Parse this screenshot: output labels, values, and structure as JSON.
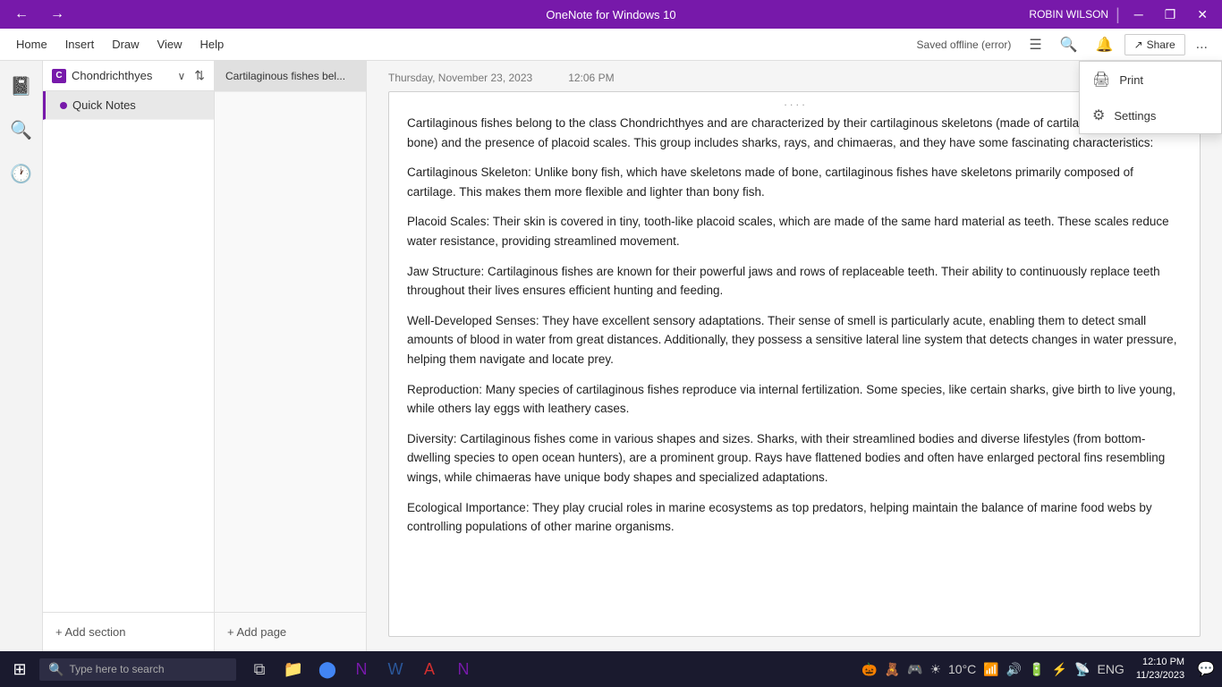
{
  "titleBar": {
    "appName": "OneNote for Windows 10",
    "userName": "ROBIN WILSON",
    "navBack": "←",
    "navForward": "→",
    "minBtn": "─",
    "maxBtn": "❐",
    "closeBtn": "✕"
  },
  "menuBar": {
    "items": [
      "Home",
      "Insert",
      "Draw",
      "View",
      "Help"
    ],
    "status": "Saved offline (error)",
    "shareBtn": "Share",
    "moreBtn": "..."
  },
  "sidePanel": {
    "notebookName": "Chondrichthyes",
    "pages": [
      {
        "label": "Quick Notes",
        "active": true
      }
    ],
    "addSection": "+ Add section",
    "addPage": "+ Add page"
  },
  "pageList": {
    "items": [
      "Cartilaginous fishes bel..."
    ]
  },
  "content": {
    "date": "Thursday, November 23, 2023",
    "time": "12:06 PM",
    "noteText": [
      "Cartilaginous fishes belong to the class Chondrichthyes and are characterized by their cartilaginous skeletons (made of cartilage instead of bone) and the presence of placoid scales. This group includes sharks, rays, and chimaeras, and they have some fascinating characteristics:",
      "Cartilaginous Skeleton: Unlike bony fish, which have skeletons made of bone, cartilaginous fishes have skeletons primarily composed of cartilage. This makes them more flexible and lighter than bony fish.",
      "Placoid Scales: Their skin is covered in tiny, tooth-like placoid scales, which are made of the same hard material as teeth. These scales reduce water resistance, providing streamlined movement.",
      "Jaw Structure: Cartilaginous fishes are known for their powerful jaws and rows of replaceable teeth. Their ability to continuously replace teeth throughout their lives ensures efficient hunting and feeding.",
      "Well-Developed Senses: They have excellent sensory adaptations. Their sense of smell is particularly acute, enabling them to detect small amounts of blood in water from great distances. Additionally, they possess a sensitive lateral line system that detects changes in water pressure, helping them navigate and locate prey.",
      "Reproduction: Many species of cartilaginous fishes reproduce via internal fertilization. Some species, like certain sharks, give birth to live young, while others lay eggs with leathery cases.",
      "Diversity: Cartilaginous fishes come in various shapes and sizes. Sharks, with their streamlined bodies and diverse lifestyles (from bottom-dwelling species to open ocean hunters), are a prominent group. Rays have flattened bodies and often have enlarged pectoral fins resembling wings, while chimaeras have unique body shapes and specialized adaptations.",
      "Ecological Importance: They play crucial roles in marine ecosystems as top predators, helping maintain the balance of marine food webs by controlling populations of other marine organisms."
    ]
  },
  "dropdown": {
    "items": [
      {
        "label": "Print",
        "icon": "🖨"
      },
      {
        "label": "Settings",
        "icon": "⚙"
      }
    ]
  },
  "taskbar": {
    "searchPlaceholder": "Type here to search",
    "time": "12:10 PM",
    "date": "11/23/2023",
    "lang": "ENG",
    "temp": "10°C"
  }
}
